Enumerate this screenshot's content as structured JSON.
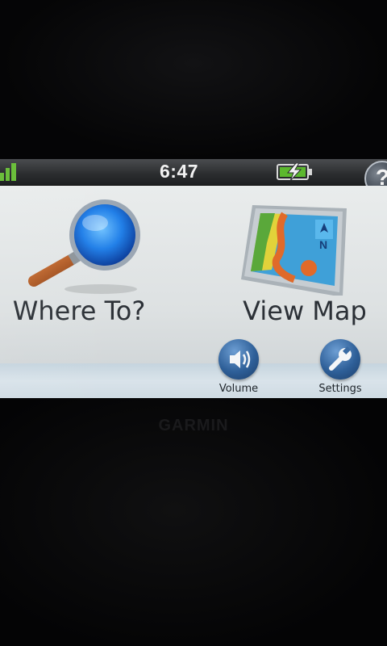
{
  "status_bar": {
    "time": "6:47",
    "signal_icon": "signal-bars-icon",
    "battery_icon": "battery-charging-icon",
    "help_label": "?"
  },
  "main_menu": {
    "where_to": {
      "label": "Where To?",
      "icon": "magnifier-icon"
    },
    "view_map": {
      "label": "View Map",
      "icon": "map-icon"
    }
  },
  "bottom_bar": {
    "volume": {
      "label": "Volume",
      "icon": "speaker-icon"
    },
    "settings": {
      "label": "Settings",
      "icon": "wrench-icon"
    }
  },
  "colors": {
    "screen_bg": "#e4e8e8",
    "status_bar": "#2e3033",
    "button_blue": "#2e5f98",
    "label_text": "#2b3036"
  }
}
